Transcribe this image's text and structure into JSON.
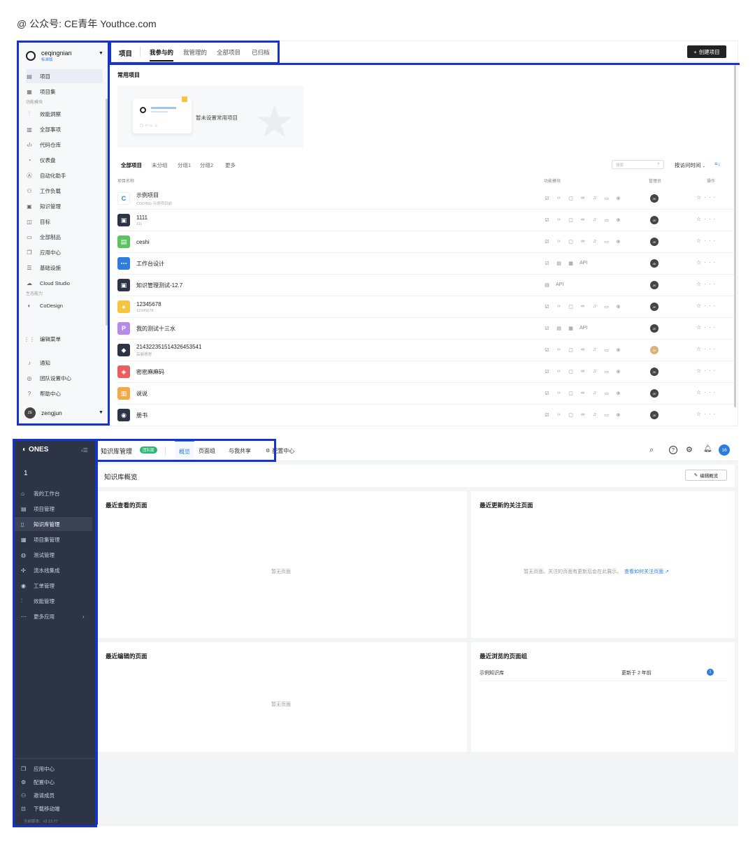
{
  "watermark": "@ 公众号: CE青年    Youthce.com",
  "shotA": {
    "team": {
      "name": "ceqingnian",
      "badge": "标准版"
    },
    "sidebar": {
      "top_items": [
        {
          "icon": "project-icon",
          "label": "项目"
        },
        {
          "icon": "project-set-icon",
          "label": "项目集"
        }
      ],
      "section1": "功能模块",
      "modules": [
        {
          "icon": "chart-icon",
          "label": "效能洞察"
        },
        {
          "icon": "list-icon",
          "label": "全部事项"
        },
        {
          "icon": "code-icon",
          "label": "代码仓库"
        },
        {
          "icon": "dashboard-icon",
          "label": "仪表盘"
        },
        {
          "icon": "robot-icon",
          "label": "自动化助手"
        },
        {
          "icon": "workload-icon",
          "label": "工作负载"
        },
        {
          "icon": "book-icon",
          "label": "知识管理"
        },
        {
          "icon": "okr-icon",
          "label": "目标"
        },
        {
          "icon": "artifact-icon",
          "label": "全部制品"
        },
        {
          "icon": "app-icon",
          "label": "应用中心"
        },
        {
          "icon": "database-icon",
          "label": "基础设施"
        },
        {
          "icon": "cloud-icon",
          "label": "Cloud Studio"
        }
      ],
      "section2": "生态能力",
      "eco": [
        {
          "icon": "codesign-icon",
          "label": "CoDesign"
        }
      ],
      "edit_menu": "编辑菜单",
      "bottom": [
        {
          "icon": "bell-icon",
          "label": "通知"
        },
        {
          "icon": "settings-icon",
          "label": "团队设置中心"
        },
        {
          "icon": "help-icon",
          "label": "帮助中心"
        }
      ],
      "user": {
        "initials": "ZE",
        "name": "zengjun"
      }
    },
    "header": {
      "title": "项目",
      "tabs": [
        "我参与的",
        "我管理的",
        "全部项目",
        "已归档"
      ],
      "create_btn": "创建项目"
    },
    "frequent": {
      "title": "常用项目",
      "empty_text": "暂未设置常用项目"
    },
    "filters": {
      "groups": [
        "全部项目",
        "未分组",
        "分组1",
        "分组2",
        "更多"
      ],
      "search_placeholder": "搜索",
      "sort": "按访问时间"
    },
    "columns": {
      "name": "项目名称",
      "modules": "功能模块",
      "admin": "管理员",
      "ops": "操作"
    },
    "projects": [
      {
        "name": "示例项目",
        "sub": "CODING 示例项目前",
        "color": "#ffffff",
        "glyph": "C",
        "modules": "full"
      },
      {
        "name": "1111",
        "sub": "111",
        "color": "#2d3446",
        "glyph": "▣",
        "modules": "full"
      },
      {
        "name": "ceshi",
        "sub": "",
        "color": "#5cc45f",
        "glyph": "▤",
        "modules": "full"
      },
      {
        "name": "工作台设计",
        "sub": "",
        "color": "#2d7de0",
        "glyph": "⋯",
        "modules": "api"
      },
      {
        "name": "知识管理测试-12.7",
        "sub": "",
        "color": "#2d3446",
        "glyph": "▣",
        "modules": "api2"
      },
      {
        "name": "12345678",
        "sub": "12345678",
        "color": "#f6c343",
        "glyph": "●",
        "modules": "full"
      },
      {
        "name": "我的测试十三水",
        "sub": "",
        "color": "#b68ae8",
        "glyph": "P",
        "modules": "api"
      },
      {
        "name": "214322351514326453541",
        "sub": "高徽嗯嗯",
        "color": "#2d3446",
        "glyph": "◆",
        "modules": "full",
        "admin_color": "#d9b37a"
      },
      {
        "name": "密密麻麻码",
        "sub": "",
        "color": "#e85d5d",
        "glyph": "◈",
        "modules": "full"
      },
      {
        "name": "说说",
        "sub": "",
        "color": "#f2a94a",
        "glyph": "▥",
        "modules": "full"
      },
      {
        "name": "册书",
        "sub": "",
        "color": "#2d3446",
        "glyph": "◉",
        "modules": "full"
      }
    ],
    "api_label": "API",
    "admin_initials": "ZE"
  },
  "shotB": {
    "brand": "ONES",
    "team_number": "1",
    "sidebar": {
      "items": [
        {
          "icon": "home-icon",
          "label": "我的工作台"
        },
        {
          "icon": "project-icon",
          "label": "项目管理"
        },
        {
          "icon": "wiki-icon",
          "label": "知识库管理",
          "active": true
        },
        {
          "icon": "project-set-icon",
          "label": "项目集管理"
        },
        {
          "icon": "test-icon",
          "label": "测试管理"
        },
        {
          "icon": "pipeline-icon",
          "label": "流水线集成"
        },
        {
          "icon": "ticket-icon",
          "label": "工单管理"
        },
        {
          "icon": "chart-icon",
          "label": "效能管理"
        },
        {
          "icon": "more-icon",
          "label": "更多应用"
        }
      ],
      "bottom": [
        {
          "icon": "app-icon",
          "label": "应用中心"
        },
        {
          "icon": "gear-icon",
          "label": "配置中心"
        },
        {
          "icon": "invite-icon",
          "label": "邀请成员"
        },
        {
          "icon": "download-icon",
          "label": "下载移动端"
        }
      ],
      "version": "当前版本：v3.13.77"
    },
    "header": {
      "title": "知识库管理",
      "badge": "团队版",
      "tabs": [
        "概览",
        "页面组",
        "与我共享",
        "配置中心"
      ],
      "notif_count": "16"
    },
    "overview": {
      "title": "知识库概览",
      "edit_btn": "编辑概览"
    },
    "cards": {
      "recent_view": {
        "title": "最近查看的页面",
        "empty": "暂无页面"
      },
      "recent_update": {
        "title": "最近更新的关注页面",
        "empty": "暂无页面。关注的页面有更新后会在此展示。",
        "link": "查看如何关注页面"
      },
      "recent_edit": {
        "title": "最近编辑的页面",
        "empty": "暂无页面"
      },
      "recent_groups": {
        "title": "最近浏览的页面组",
        "row": {
          "name": "示例知识库",
          "time": "更新于 2 年前",
          "count": "1"
        }
      }
    }
  }
}
